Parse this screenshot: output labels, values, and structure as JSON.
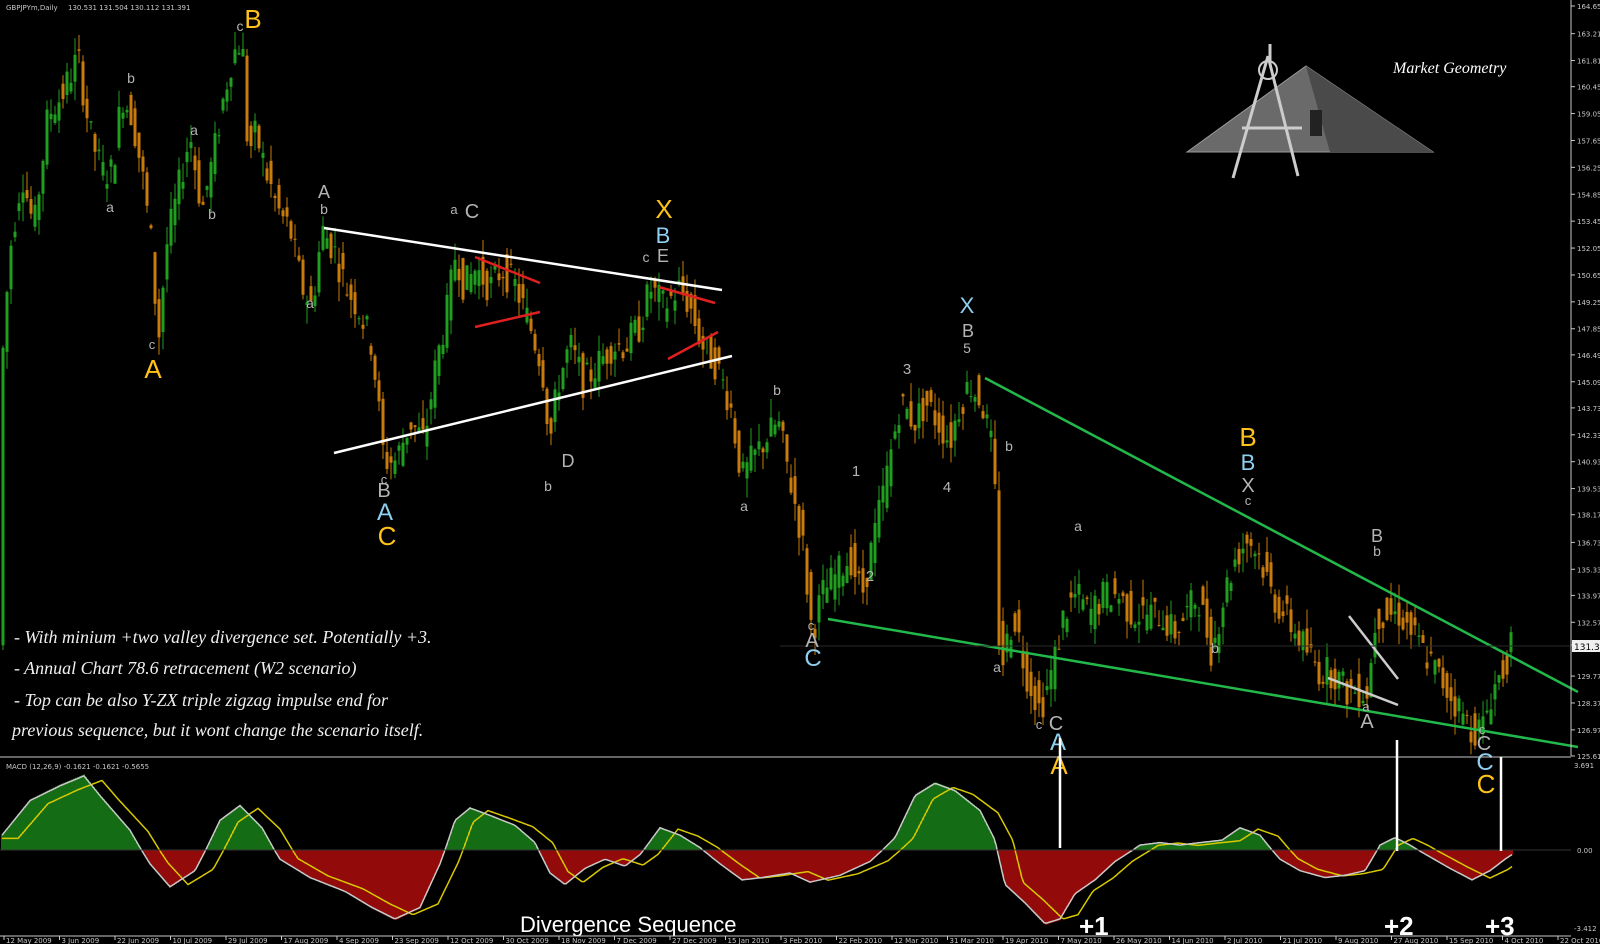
{
  "window": {
    "symbol_info": "GBPJPYm,Daily",
    "ohlc": "130.531 131.504 130.112 131.391"
  },
  "logo": {
    "text": "Market Geometry"
  },
  "notes": [
    "- With minium +two valley divergence set. Potentially +3.",
    "- Annual Chart 78.6 retracement (W2 scenario)",
    "- Top can be also Y-ZX triple zigzag impulse end for",
    "previous sequence, but it wont change the scenario itself."
  ],
  "divergence": {
    "title": "Divergence Sequence",
    "marks": [
      "+1",
      "+2",
      "+3"
    ]
  },
  "colors": {
    "background": "#000000",
    "bull_candle": "#1f9e1f",
    "bear_candle": "#c87a0a",
    "label_gray": "#b4b4b4",
    "label_yellow": "#ffc21a",
    "label_blue": "#8fd0f0",
    "triangle_line": "#ffffff",
    "wedge_line": "#22b84a",
    "red_line": "#e02020",
    "macd_green": "#1fa81f",
    "macd_red": "#e01010",
    "macd_signal": "#d8c800",
    "macd_line": "#c8c8c8"
  },
  "chart_data": [
    {
      "type": "candlestick",
      "title": "GBPJPYm,Daily",
      "ylim": [
        125.61,
        164.65
      ],
      "price_ticks": [
        "164.65",
        "163.21",
        "161.81",
        "160.45",
        "159.05",
        "157.65",
        "156.25",
        "154.85",
        "153.45",
        "152.05",
        "150.65",
        "149.25",
        "147.85",
        "146.49",
        "145.09",
        "143.73",
        "142.33",
        "140.93",
        "139.53",
        "138.17",
        "136.73",
        "135.33",
        "133.97",
        "132.57",
        "131.39",
        "129.77",
        "128.37",
        "126.97",
        "125.61"
      ],
      "current_price": "131.391",
      "x_ticks": [
        "12 May 2009",
        "3 Jun 2009",
        "22 Jun 2009",
        "10 Jul 2009",
        "29 Jul 2009",
        "17 Aug 2009",
        "4 Sep 2009",
        "23 Sep 2009",
        "12 Oct 2009",
        "30 Oct 2009",
        "18 Nov 2009",
        "7 Dec 2009",
        "27 Dec 2009",
        "15 Jan 2010",
        "3 Feb 2010",
        "22 Feb 2010",
        "12 Mar 2010",
        "31 Mar 2010",
        "19 Apr 2010",
        "7 May 2010",
        "26 May 2010",
        "14 Jun 2010",
        "2 Jul 2010",
        "21 Jul 2010",
        "9 Aug 2010",
        "27 Aug 2010",
        "15 Sep 2010",
        "4 Oct 2010",
        "22 Oct 2010"
      ],
      "close_path": [
        [
          0,
          144.5
        ],
        [
          10,
          152
        ],
        [
          22,
          156
        ],
        [
          34,
          153
        ],
        [
          48,
          159
        ],
        [
          62,
          160
        ],
        [
          78,
          162
        ],
        [
          90,
          158
        ],
        [
          102,
          156
        ],
        [
          112,
          156
        ],
        [
          122,
          160
        ],
        [
          132,
          159
        ],
        [
          142,
          156
        ],
        [
          152,
          152
        ],
        [
          158,
          147
        ],
        [
          166,
          152
        ],
        [
          178,
          155
        ],
        [
          190,
          158
        ],
        [
          202,
          154
        ],
        [
          214,
          157
        ],
        [
          224,
          160
        ],
        [
          232,
          162
        ],
        [
          242,
          163
        ],
        [
          248,
          157
        ],
        [
          256,
          158
        ],
        [
          266,
          156
        ],
        [
          278,
          154
        ],
        [
          290,
          153
        ],
        [
          302,
          150
        ],
        [
          312,
          149
        ],
        [
          322,
          153
        ],
        [
          334,
          152
        ],
        [
          346,
          150
        ],
        [
          358,
          149
        ],
        [
          372,
          147
        ],
        [
          384,
          141
        ],
        [
          396,
          141
        ],
        [
          410,
          143
        ],
        [
          424,
          142
        ],
        [
          436,
          146
        ],
        [
          448,
          149
        ],
        [
          456,
          152
        ],
        [
          464,
          150
        ],
        [
          476,
          151
        ],
        [
          490,
          150
        ],
        [
          502,
          151
        ],
        [
          516,
          150
        ],
        [
          530,
          148
        ],
        [
          542,
          146
        ],
        [
          550,
          142
        ],
        [
          558,
          145
        ],
        [
          570,
          147
        ],
        [
          584,
          145
        ],
        [
          598,
          146
        ],
        [
          612,
          147
        ],
        [
          626,
          147
        ],
        [
          640,
          148
        ],
        [
          650,
          150
        ],
        [
          664,
          149
        ],
        [
          680,
          150
        ],
        [
          690,
          149
        ],
        [
          702,
          147
        ],
        [
          716,
          146
        ],
        [
          730,
          144
        ],
        [
          742,
          140
        ],
        [
          752,
          141
        ],
        [
          764,
          142
        ],
        [
          778,
          143
        ],
        [
          790,
          140
        ],
        [
          802,
          137
        ],
        [
          812,
          132
        ],
        [
          822,
          134
        ],
        [
          836,
          135
        ],
        [
          850,
          136
        ],
        [
          862,
          134
        ],
        [
          874,
          137
        ],
        [
          886,
          140
        ],
        [
          900,
          144
        ],
        [
          914,
          143
        ],
        [
          926,
          144
        ],
        [
          938,
          143
        ],
        [
          950,
          142
        ],
        [
          960,
          144
        ],
        [
          970,
          145
        ],
        [
          982,
          144
        ],
        [
          994,
          141
        ],
        [
          1000,
          130
        ],
        [
          1014,
          133
        ],
        [
          1026,
          130
        ],
        [
          1040,
          128
        ],
        [
          1052,
          130
        ],
        [
          1064,
          133
        ],
        [
          1076,
          134
        ],
        [
          1090,
          133
        ],
        [
          1104,
          134
        ],
        [
          1118,
          134
        ],
        [
          1132,
          133
        ],
        [
          1146,
          133
        ],
        [
          1160,
          133
        ],
        [
          1174,
          132
        ],
        [
          1186,
          133
        ],
        [
          1198,
          134
        ],
        [
          1212,
          131
        ],
        [
          1224,
          134
        ],
        [
          1236,
          136
        ],
        [
          1248,
          137
        ],
        [
          1260,
          136
        ],
        [
          1272,
          134
        ],
        [
          1284,
          133
        ],
        [
          1296,
          132
        ],
        [
          1308,
          131
        ],
        [
          1320,
          130
        ],
        [
          1334,
          130
        ],
        [
          1346,
          129
        ],
        [
          1358,
          129
        ],
        [
          1368,
          129
        ],
        [
          1376,
          133
        ],
        [
          1388,
          133
        ],
        [
          1400,
          133
        ],
        [
          1412,
          132
        ],
        [
          1424,
          131
        ],
        [
          1436,
          130
        ],
        [
          1448,
          129
        ],
        [
          1460,
          128
        ],
        [
          1472,
          127
        ],
        [
          1482,
          127
        ],
        [
          1492,
          129
        ],
        [
          1502,
          130
        ],
        [
          1512,
          131.39
        ]
      ]
    },
    {
      "type": "histogram",
      "title": "MACD (12,26,9) -0.1621 -0.1621 -0.5655",
      "ylim": [
        -3.412,
        3.691
      ],
      "tick_labels": [
        "3.691",
        "0.00",
        "-3.412"
      ],
      "histogram_path": [
        [
          0,
          0.5
        ],
        [
          30,
          2.0
        ],
        [
          60,
          2.6
        ],
        [
          84,
          3.0
        ],
        [
          100,
          2.2
        ],
        [
          130,
          0.8
        ],
        [
          150,
          -0.6
        ],
        [
          170,
          -1.6
        ],
        [
          195,
          -0.9
        ],
        [
          220,
          1.2
        ],
        [
          240,
          1.8
        ],
        [
          262,
          0.9
        ],
        [
          280,
          -0.4
        ],
        [
          310,
          -1.2
        ],
        [
          345,
          -1.8
        ],
        [
          372,
          -2.5
        ],
        [
          395,
          -3.0
        ],
        [
          420,
          -2.5
        ],
        [
          440,
          -0.6
        ],
        [
          455,
          1.2
        ],
        [
          470,
          1.7
        ],
        [
          490,
          1.4
        ],
        [
          515,
          1.0
        ],
        [
          535,
          0.3
        ],
        [
          550,
          -1.0
        ],
        [
          565,
          -1.5
        ],
        [
          585,
          -0.8
        ],
        [
          605,
          -0.4
        ],
        [
          625,
          -0.7
        ],
        [
          640,
          -0.2
        ],
        [
          660,
          0.9
        ],
        [
          680,
          0.6
        ],
        [
          700,
          0.1
        ],
        [
          720,
          -0.6
        ],
        [
          742,
          -1.3
        ],
        [
          762,
          -1.2
        ],
        [
          790,
          -1.0
        ],
        [
          810,
          -1.4
        ],
        [
          840,
          -1.1
        ],
        [
          870,
          -0.5
        ],
        [
          895,
          0.5
        ],
        [
          915,
          2.2
        ],
        [
          935,
          2.7
        ],
        [
          955,
          2.4
        ],
        [
          980,
          1.6
        ],
        [
          995,
          0.4
        ],
        [
          1005,
          -1.5
        ],
        [
          1025,
          -2.3
        ],
        [
          1045,
          -3.2
        ],
        [
          1060,
          -3.0
        ],
        [
          1075,
          -1.9
        ],
        [
          1095,
          -1.3
        ],
        [
          1115,
          -0.5
        ],
        [
          1140,
          0.2
        ],
        [
          1160,
          0.3
        ],
        [
          1180,
          0.2
        ],
        [
          1200,
          0.3
        ],
        [
          1222,
          0.4
        ],
        [
          1240,
          0.9
        ],
        [
          1260,
          0.6
        ],
        [
          1280,
          -0.4
        ],
        [
          1300,
          -0.9
        ],
        [
          1325,
          -1.2
        ],
        [
          1345,
          -1.1
        ],
        [
          1365,
          -0.9
        ],
        [
          1380,
          0.2
        ],
        [
          1395,
          0.5
        ],
        [
          1410,
          0.2
        ],
        [
          1430,
          -0.3
        ],
        [
          1450,
          -0.8
        ],
        [
          1472,
          -1.3
        ],
        [
          1490,
          -0.9
        ],
        [
          1505,
          -0.4
        ],
        [
          1512,
          -0.2
        ]
      ],
      "annotations": [
        "Divergence Sequence",
        "+1",
        "+2",
        "+3"
      ]
    }
  ],
  "wave_labels": [
    {
      "t": "c",
      "c": "label_gray",
      "x": 152,
      "y": 349,
      "s": 13
    },
    {
      "t": "A",
      "c": "label_yellow",
      "x": 153,
      "y": 378,
      "s": 26
    },
    {
      "t": "b",
      "c": "label_gray",
      "x": 131,
      "y": 83,
      "s": 14
    },
    {
      "t": "a",
      "c": "label_gray",
      "x": 194,
      "y": 135,
      "s": 14
    },
    {
      "t": "a",
      "c": "label_gray",
      "x": 110,
      "y": 212,
      "s": 14
    },
    {
      "t": "b",
      "c": "label_gray",
      "x": 212,
      "y": 219,
      "s": 14
    },
    {
      "t": "c",
      "c": "label_gray",
      "x": 240,
      "y": 31,
      "s": 14
    },
    {
      "t": "B",
      "c": "label_yellow",
      "x": 253,
      "y": 28,
      "s": 26
    },
    {
      "t": "A",
      "c": "label_gray",
      "x": 324,
      "y": 198,
      "s": 18
    },
    {
      "t": "b",
      "c": "label_gray",
      "x": 324,
      "y": 214,
      "s": 14
    },
    {
      "t": "a",
      "c": "label_gray",
      "x": 310,
      "y": 308,
      "s": 14
    },
    {
      "t": "c",
      "c": "label_gray",
      "x": 384,
      "y": 484,
      "s": 13
    },
    {
      "t": "B",
      "c": "label_gray",
      "x": 384,
      "y": 497,
      "s": 20
    },
    {
      "t": "A",
      "c": "label_blue",
      "x": 385,
      "y": 520,
      "s": 24
    },
    {
      "t": "C",
      "c": "label_yellow",
      "x": 387,
      "y": 545,
      "s": 26
    },
    {
      "t": "a",
      "c": "label_gray",
      "x": 454,
      "y": 214,
      "s": 13
    },
    {
      "t": "C",
      "c": "label_gray",
      "x": 472,
      "y": 218,
      "s": 20
    },
    {
      "t": "D",
      "c": "label_gray",
      "x": 568,
      "y": 467,
      "s": 18
    },
    {
      "t": "b",
      "c": "label_gray",
      "x": 548,
      "y": 491,
      "s": 14
    },
    {
      "t": "X",
      "c": "label_yellow",
      "x": 664,
      "y": 218,
      "s": 26
    },
    {
      "t": "B",
      "c": "label_blue",
      "x": 663,
      "y": 243,
      "s": 22
    },
    {
      "t": "c",
      "c": "label_gray",
      "x": 646,
      "y": 262,
      "s": 14
    },
    {
      "t": "E",
      "c": "label_gray",
      "x": 663,
      "y": 262,
      "s": 18
    },
    {
      "t": "b",
      "c": "label_gray",
      "x": 777,
      "y": 395,
      "s": 14
    },
    {
      "t": "a",
      "c": "label_gray",
      "x": 744,
      "y": 511,
      "s": 14
    },
    {
      "t": "1",
      "c": "label_gray",
      "x": 856,
      "y": 476,
      "s": 15
    },
    {
      "t": "2",
      "c": "label_gray",
      "x": 870,
      "y": 581,
      "s": 15
    },
    {
      "t": "3",
      "c": "label_gray",
      "x": 907,
      "y": 374,
      "s": 15
    },
    {
      "t": "4",
      "c": "label_gray",
      "x": 947,
      "y": 492,
      "s": 15
    },
    {
      "t": "X",
      "c": "label_blue",
      "x": 967,
      "y": 313,
      "s": 22
    },
    {
      "t": "B",
      "c": "label_gray",
      "x": 968,
      "y": 337,
      "s": 18
    },
    {
      "t": "5",
      "c": "label_gray",
      "x": 967,
      "y": 353,
      "s": 14
    },
    {
      "t": "b",
      "c": "label_gray",
      "x": 1009,
      "y": 451,
      "s": 14
    },
    {
      "t": "c",
      "c": "label_gray",
      "x": 811,
      "y": 630,
      "s": 13
    },
    {
      "t": "A",
      "c": "label_gray",
      "x": 812,
      "y": 647,
      "s": 20
    },
    {
      "t": "C",
      "c": "label_blue",
      "x": 813,
      "y": 666,
      "s": 24
    },
    {
      "t": "a",
      "c": "label_gray",
      "x": 997,
      "y": 672,
      "s": 14
    },
    {
      "t": "a",
      "c": "label_gray",
      "x": 1078,
      "y": 531,
      "s": 14
    },
    {
      "t": "b",
      "c": "label_gray",
      "x": 1215,
      "y": 653,
      "s": 14
    },
    {
      "t": "c",
      "c": "label_gray",
      "x": 1039,
      "y": 729,
      "s": 13
    },
    {
      "t": "C",
      "c": "label_gray",
      "x": 1056,
      "y": 730,
      "s": 20
    },
    {
      "t": "A",
      "c": "label_blue",
      "x": 1058,
      "y": 750,
      "s": 24
    },
    {
      "t": "A",
      "c": "label_yellow",
      "x": 1059,
      "y": 774,
      "s": 26
    },
    {
      "t": "B",
      "c": "label_yellow",
      "x": 1248,
      "y": 446,
      "s": 26
    },
    {
      "t": "B",
      "c": "label_blue",
      "x": 1248,
      "y": 470,
      "s": 22
    },
    {
      "t": "X",
      "c": "label_gray",
      "x": 1248,
      "y": 492,
      "s": 20
    },
    {
      "t": "c",
      "c": "label_gray",
      "x": 1248,
      "y": 505,
      "s": 13
    },
    {
      "t": "B",
      "c": "label_gray",
      "x": 1377,
      "y": 542,
      "s": 18
    },
    {
      "t": "b",
      "c": "label_gray",
      "x": 1377,
      "y": 556,
      "s": 14
    },
    {
      "t": "a",
      "c": "label_gray",
      "x": 1366,
      "y": 711,
      "s": 13
    },
    {
      "t": "A",
      "c": "label_gray",
      "x": 1367,
      "y": 728,
      "s": 20
    },
    {
      "t": "c",
      "c": "label_gray",
      "x": 1482,
      "y": 734,
      "s": 13
    },
    {
      "t": "C",
      "c": "label_gray",
      "x": 1484,
      "y": 750,
      "s": 20
    },
    {
      "t": "C",
      "c": "label_blue",
      "x": 1485,
      "y": 770,
      "s": 24
    },
    {
      "t": "C",
      "c": "label_yellow",
      "x": 1486,
      "y": 793,
      "s": 26
    }
  ]
}
